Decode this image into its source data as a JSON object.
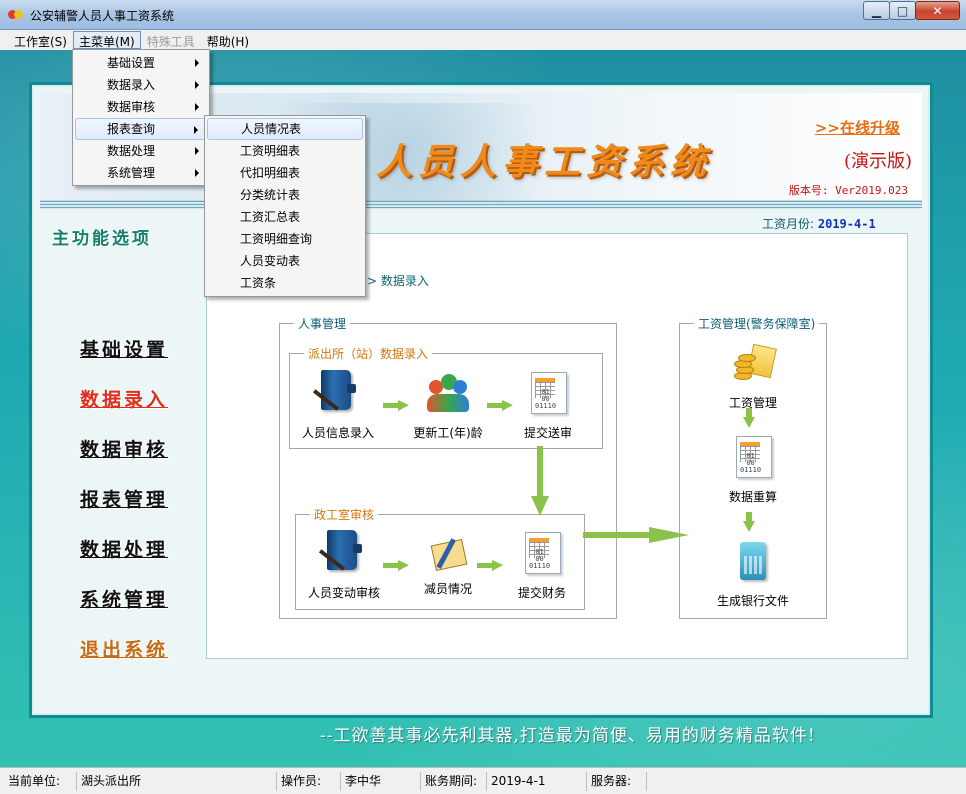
{
  "window": {
    "title": "公安辅警人员人事工资系统",
    "minimize": "▁",
    "maximize": "□",
    "close": "✕"
  },
  "menubar": [
    {
      "label": "工作室(S)"
    },
    {
      "label": "主菜单(M)"
    },
    {
      "label": "特殊工具"
    },
    {
      "label": "帮助(H)"
    }
  ],
  "main_menu": {
    "items": [
      "基础设置",
      "数据录入",
      "数据审核",
      "报表查询",
      "数据处理",
      "系统管理"
    ]
  },
  "report_submenu": {
    "items": [
      "人员情况表",
      "工资明细表",
      "代扣明细表",
      "分类统计表",
      "工资汇总表",
      "工资明细查询",
      "人员变动表",
      "工资条"
    ]
  },
  "banner": {
    "title": "人员人事工资系统",
    "upgrade": ">>在线升级",
    "demo": "(演示版)",
    "version": "版本号: Ver2019.023"
  },
  "pay_month": {
    "label": "工资月份:",
    "value": "2019-4-1"
  },
  "sidebar": {
    "title": "主功能选项",
    "items": [
      "基础设置",
      "数据录入",
      "数据审核",
      "报表管理",
      "数据处理",
      "系统管理",
      "退出系统"
    ]
  },
  "breadcrumb": "> 数据录入",
  "flow": {
    "hr_group": "人事管理",
    "station_group": "派出所（站）数据录入",
    "station_nodes": [
      "人员信息录入",
      "更新工(年)龄",
      "提交送审"
    ],
    "political_group": "政工室审核",
    "political_nodes": [
      "人员变动审核",
      "减员情况",
      "提交财务"
    ],
    "payroll_group": "工资管理(警务保障室)",
    "payroll_nodes": [
      "工资管理",
      "数据重算",
      "生成银行文件"
    ]
  },
  "slogan": "--工欲善其事必先利其器,打造最为简便、易用的财务精品软件!",
  "statusbar": {
    "unit_label": "当前单位:",
    "unit_value": "湖头派出所",
    "operator_label": "操作员:",
    "operator_value": "李中华",
    "period_label": "账务期间:",
    "period_value": "2019-4-1",
    "server_label": "服务器:",
    "server_value": ""
  },
  "colors": {
    "accent": "#1faab3",
    "title_orange": "#f08a1b",
    "red": "#e02d1c",
    "flow_arrow": "#8bc24a"
  }
}
